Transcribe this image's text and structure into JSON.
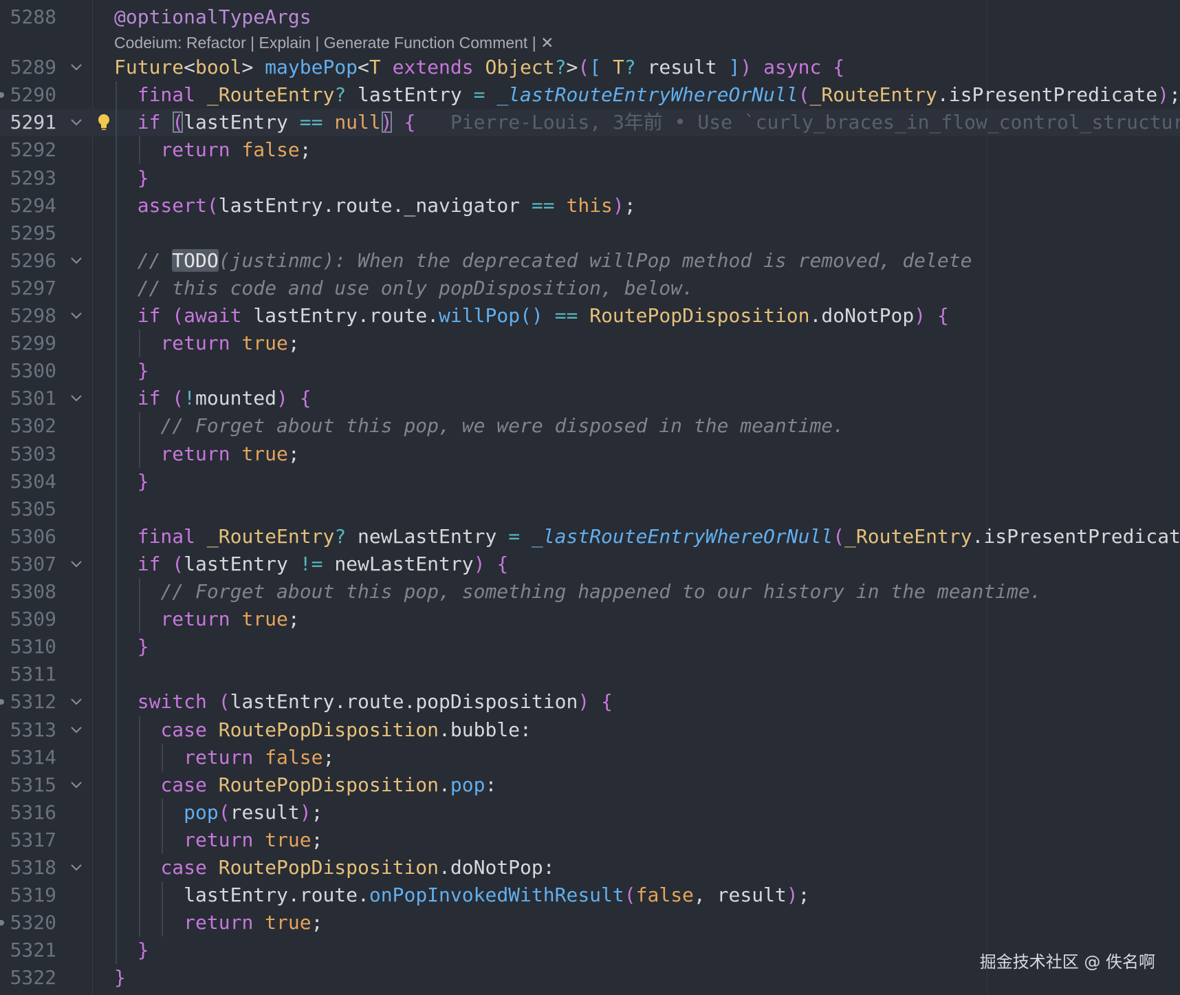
{
  "editor": {
    "codelens": {
      "label": "Codeium: ",
      "actions": [
        "Refactor",
        "Explain",
        "Generate Function Comment"
      ],
      "separator": " | ",
      "close_glyph": "✕"
    },
    "blame": "Pierre-Louis, 3年前 • Use `curly_braces_in_flow_control_structur",
    "watermark": "掘金技术社区 @ 佚名啊",
    "current_line": "5291",
    "colors": {
      "background": "#282c34",
      "keyword": "#c678dd",
      "type": "#e5c07b",
      "function": "#61afef",
      "operator": "#56b6c2",
      "comment": "#7f848e",
      "boolean": "#e5a55b"
    },
    "lines": [
      {
        "num": "5288",
        "text": "@optionalTypeArgs"
      },
      {
        "num": "5289",
        "text": "Future<bool> maybePop<T extends Object?>([ T? result ]) async {"
      },
      {
        "num": "5290",
        "text": "  final _RouteEntry? lastEntry = _lastRouteEntryWhereOrNull(_RouteEntry.isPresentPredicate);"
      },
      {
        "num": "5291",
        "text": "  if (lastEntry == null) {"
      },
      {
        "num": "5292",
        "text": "    return false;"
      },
      {
        "num": "5293",
        "text": "  }"
      },
      {
        "num": "5294",
        "text": "  assert(lastEntry.route._navigator == this);"
      },
      {
        "num": "5295",
        "text": ""
      },
      {
        "num": "5296",
        "text": "  // TODO(justinmc): When the deprecated willPop method is removed, delete"
      },
      {
        "num": "5297",
        "text": "  // this code and use only popDisposition, below."
      },
      {
        "num": "5298",
        "text": "  if (await lastEntry.route.willPop() == RoutePopDisposition.doNotPop) {"
      },
      {
        "num": "5299",
        "text": "    return true;"
      },
      {
        "num": "5300",
        "text": "  }"
      },
      {
        "num": "5301",
        "text": "  if (!mounted) {"
      },
      {
        "num": "5302",
        "text": "    // Forget about this pop, we were disposed in the meantime."
      },
      {
        "num": "5303",
        "text": "    return true;"
      },
      {
        "num": "5304",
        "text": "  }"
      },
      {
        "num": "5305",
        "text": ""
      },
      {
        "num": "5306",
        "text": "  final _RouteEntry? newLastEntry = _lastRouteEntryWhereOrNull(_RouteEntry.isPresentPredicate);"
      },
      {
        "num": "5307",
        "text": "  if (lastEntry != newLastEntry) {"
      },
      {
        "num": "5308",
        "text": "    // Forget about this pop, something happened to our history in the meantime."
      },
      {
        "num": "5309",
        "text": "    return true;"
      },
      {
        "num": "5310",
        "text": "  }"
      },
      {
        "num": "5311",
        "text": ""
      },
      {
        "num": "5312",
        "text": "  switch (lastEntry.route.popDisposition) {"
      },
      {
        "num": "5313",
        "text": "    case RoutePopDisposition.bubble:"
      },
      {
        "num": "5314",
        "text": "      return false;"
      },
      {
        "num": "5315",
        "text": "    case RoutePopDisposition.pop:"
      },
      {
        "num": "5316",
        "text": "      pop(result);"
      },
      {
        "num": "5317",
        "text": "      return true;"
      },
      {
        "num": "5318",
        "text": "    case RoutePopDisposition.doNotPop:"
      },
      {
        "num": "5319",
        "text": "      lastEntry.route.onPopInvokedWithResult(false, result);"
      },
      {
        "num": "5320",
        "text": "      return true;"
      },
      {
        "num": "5321",
        "text": "  }"
      },
      {
        "num": "5322",
        "text": "}"
      }
    ]
  }
}
